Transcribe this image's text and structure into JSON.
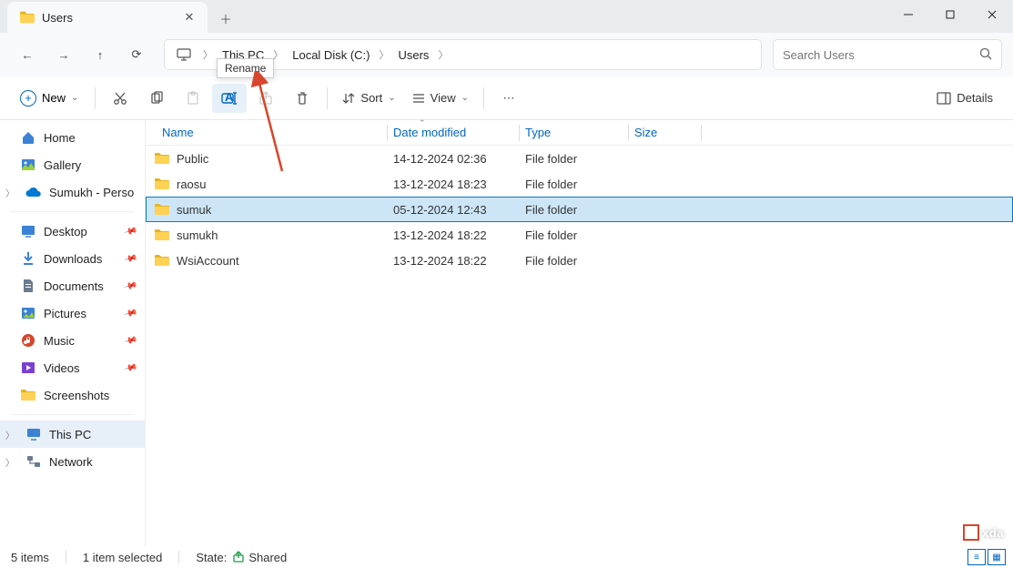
{
  "tab": {
    "title": "Users"
  },
  "tooltip": "Rename",
  "breadcrumb": {
    "pc": "This PC",
    "disk": "Local Disk (C:)",
    "folder": "Users"
  },
  "search": {
    "placeholder": "Search Users"
  },
  "toolbar": {
    "new_label": "New",
    "sort_label": "Sort",
    "view_label": "View",
    "details_label": "Details"
  },
  "columns": {
    "name": "Name",
    "date": "Date modified",
    "type": "Type",
    "size": "Size"
  },
  "files": [
    {
      "name": "Public",
      "date": "14-12-2024 02:36",
      "type": "File folder",
      "size": ""
    },
    {
      "name": "raosu",
      "date": "13-12-2024 18:23",
      "type": "File folder",
      "size": ""
    },
    {
      "name": "sumuk",
      "date": "05-12-2024 12:43",
      "type": "File folder",
      "size": "",
      "selected": true
    },
    {
      "name": "sumukh",
      "date": "13-12-2024 18:22",
      "type": "File folder",
      "size": ""
    },
    {
      "name": "WsiAccount",
      "date": "13-12-2024 18:22",
      "type": "File folder",
      "size": ""
    }
  ],
  "sidebar": {
    "home": "Home",
    "gallery": "Gallery",
    "onedrive": "Sumukh - Perso",
    "desktop": "Desktop",
    "downloads": "Downloads",
    "documents": "Documents",
    "pictures": "Pictures",
    "music": "Music",
    "videos": "Videos",
    "screenshots": "Screenshots",
    "thispc": "This PC",
    "network": "Network"
  },
  "status": {
    "count": "5 items",
    "selected": "1 item selected",
    "state_label": "State:",
    "shared": "Shared"
  },
  "watermark": "xda"
}
